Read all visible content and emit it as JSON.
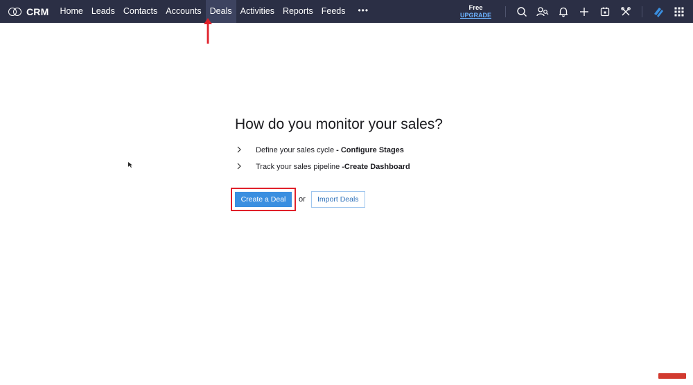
{
  "app": {
    "logo_text": "CRM"
  },
  "nav": {
    "items": [
      {
        "label": "Home",
        "active": false
      },
      {
        "label": "Leads",
        "active": false
      },
      {
        "label": "Contacts",
        "active": false
      },
      {
        "label": "Accounts",
        "active": false
      },
      {
        "label": "Deals",
        "active": true
      },
      {
        "label": "Activities",
        "active": false
      },
      {
        "label": "Reports",
        "active": false
      },
      {
        "label": "Feeds",
        "active": false
      }
    ],
    "more_label": "•••"
  },
  "plan": {
    "free_label": "Free",
    "upgrade_label": "UPGRADE"
  },
  "toolbar_icons": [
    "search-icon",
    "contacts-search-icon",
    "bell-icon",
    "plus-icon",
    "calendar-icon",
    "tools-icon",
    "zoho-logo-icon",
    "apps-grid-icon"
  ],
  "content": {
    "title": "How do you monitor your sales?",
    "steps": [
      {
        "text": "Define your sales cycle",
        "strong": "- Configure Stages"
      },
      {
        "text": "Track your sales pipeline",
        "strong": "-Create Dashboard"
      }
    ],
    "create_button": "Create a Deal",
    "or_text": "or",
    "import_button": "Import Deals"
  },
  "colors": {
    "topbar": "#2b2f45",
    "primary_button": "#3a8fe0",
    "annotation_red": "#e0202a",
    "upgrade_link": "#6cb2ff"
  }
}
